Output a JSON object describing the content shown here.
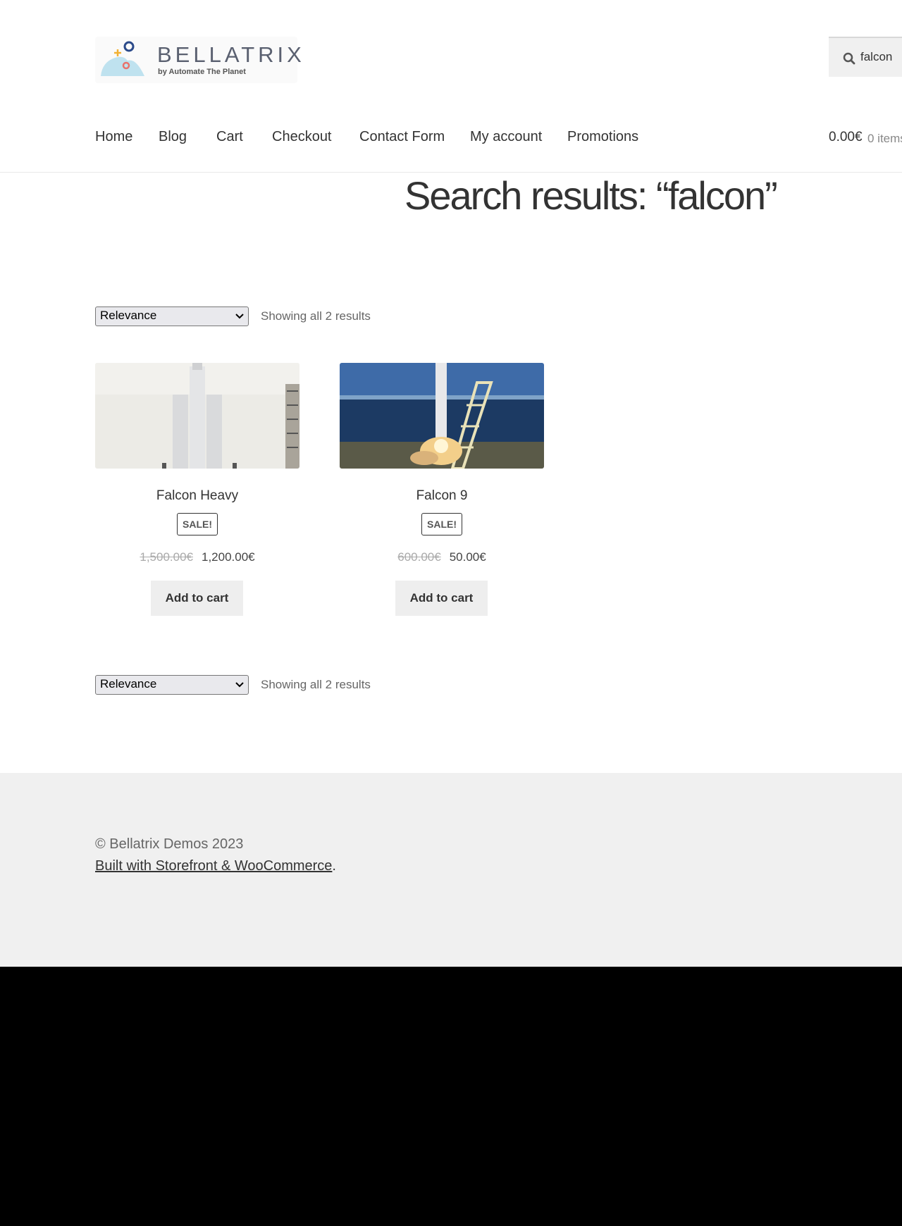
{
  "brand": {
    "name": "BELLATRIX",
    "tagline": "by Automate The Planet"
  },
  "search": {
    "value": "falcon",
    "icon": "search-icon"
  },
  "nav": {
    "items": [
      {
        "label": "Home"
      },
      {
        "label": "Blog"
      },
      {
        "label": "Cart"
      },
      {
        "label": "Checkout"
      },
      {
        "label": "Contact Form"
      },
      {
        "label": "My account"
      },
      {
        "label": "Promotions"
      }
    ]
  },
  "cart": {
    "total": "0.00€",
    "count": "0 items"
  },
  "page": {
    "title": "Search results: “falcon”"
  },
  "toolbar": {
    "sort_value": "Relevance",
    "result_count": "Showing all 2 results"
  },
  "products": [
    {
      "title": "Falcon Heavy",
      "badge": "SALE!",
      "old_price": "1,500.00€",
      "new_price": "1,200.00€",
      "button": "Add to cart"
    },
    {
      "title": "Falcon 9",
      "badge": "SALE!",
      "old_price": "600.00€",
      "new_price": "50.00€",
      "button": "Add to cart"
    }
  ],
  "footer": {
    "copyright": "© Bellatrix Demos 2023",
    "built_with_link": "Built with Storefront & WooCommerce",
    "built_with_suffix": "."
  },
  "colors": {
    "page_bg": "#ffffff",
    "footer_bg": "#f0f0f0",
    "button_bg": "#eeeeee",
    "text": "#333333"
  }
}
